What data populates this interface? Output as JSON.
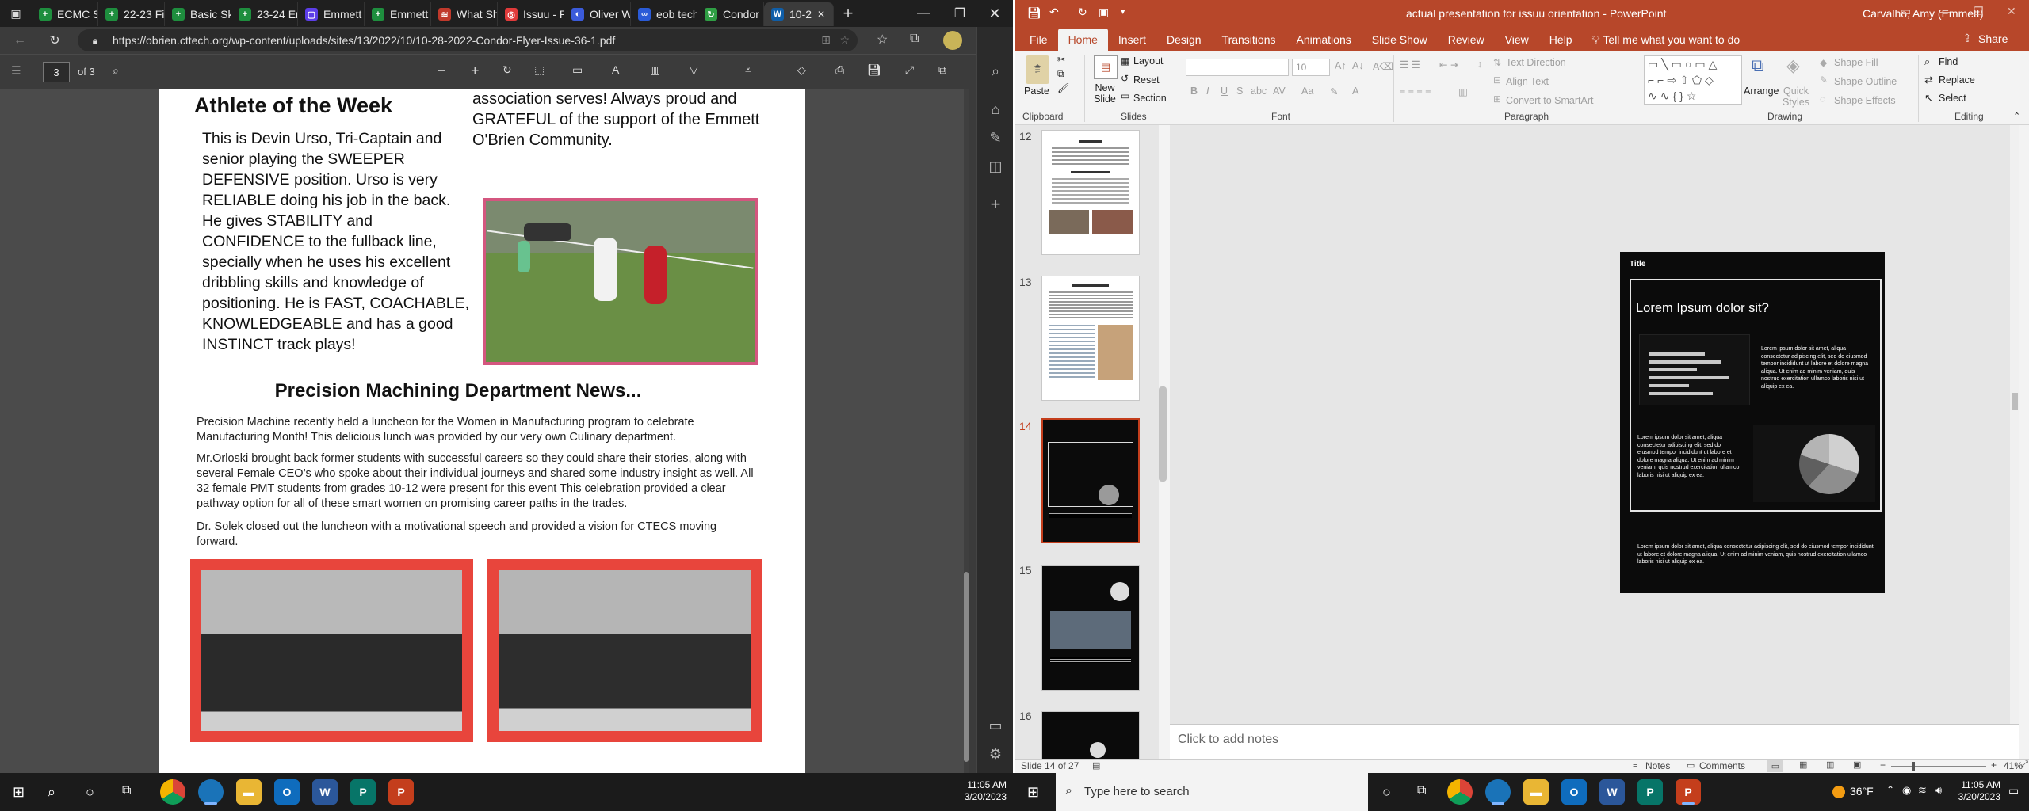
{
  "edge": {
    "tabs": [
      {
        "label": "ECMC St",
        "color": "#1e8e3e",
        "glyph": "+"
      },
      {
        "label": "22-23 Fi",
        "color": "#1e8e3e",
        "glyph": "+"
      },
      {
        "label": "Basic Ski",
        "color": "#1e8e3e",
        "glyph": "+"
      },
      {
        "label": "23-24 Er",
        "color": "#1e8e3e",
        "glyph": "+"
      },
      {
        "label": "Emmett",
        "color": "#5c3ee8",
        "glyph": "▢"
      },
      {
        "label": "Emmett",
        "color": "#1e8e3e",
        "glyph": "+"
      },
      {
        "label": "What Sh",
        "color": "#c0392b",
        "glyph": "≋"
      },
      {
        "label": "Issuu - P",
        "color": "#e03a3a",
        "glyph": "◎"
      },
      {
        "label": "Oliver W",
        "color": "#3b5bdb",
        "glyph": "◐"
      },
      {
        "label": "eob tech",
        "color": "#2a5bd7",
        "glyph": "∞"
      },
      {
        "label": "Condor I",
        "color": "#2f9e44",
        "glyph": "↻"
      },
      {
        "label": "10-2",
        "color": "#0f5ea8",
        "glyph": "W"
      }
    ],
    "url": "https://obrien.cttech.org/wp-content/uploads/sites/13/2022/10/10-28-2022-Condor-Flyer-Issue-36-1.pdf",
    "pdf": {
      "page": "3",
      "of": "of 3"
    },
    "doc": {
      "partial_top": "association serves! Always proud and GRATEFUL of the support of the Emmett O'Brien Community.",
      "athlete_title": "Athlete of the Week",
      "athlete_body": "This is Devin Urso, Tri-Captain and senior playing the SWEEPER DEFENSIVE position.  Urso is very RELIABLE doing his job in the back. He gives STABILITY and CONFIDENCE to the fullback line, specially when he uses his excellent dribbling skills and knowledge of positioning.  He is FAST, COACHABLE, KNOWLEDGEABLE and has a good INSTINCT track plays!",
      "pm_title": "Precision Machining Department News...",
      "pm_p1": "Precision Machine recently held a luncheon for the Women in Manufacturing program to celebrate Manufacturing Month! This  delicious lunch was provided by our very own Culinary department.",
      "pm_p2": "Mr.Orloski brought back former students with successful careers so they could share their stories, along with several Female CEO’s who spoke about their individual journeys and shared some industry insight as well. All 32 female PMT students from grades 10-12 were present for this event This celebration provided a clear pathway option for all of these smart women on promising career paths in the trades.",
      "pm_p3": "Dr. Solek closed out the luncheon with a motivational speech and provided a vision for CTECS moving forward.",
      "photo_border": "#e8453c"
    }
  },
  "ppt": {
    "title": "actual presentation for issuu orientation  -  PowerPoint",
    "user": "Carvalho, Amy (Emmett)",
    "tabs": [
      "File",
      "Home",
      "Insert",
      "Design",
      "Transitions",
      "Animations",
      "Slide Show",
      "Review",
      "View",
      "Help"
    ],
    "tell_me": "Tell me what you want to do",
    "share": "Share",
    "ribbon": {
      "paste": "Paste",
      "new_slide": "New Slide",
      "layout": "Layout",
      "reset": "Reset",
      "section": "Section",
      "font_size": "10",
      "text_direction": "Text Direction",
      "align_text": "Align Text",
      "convert_smartart": "Convert to SmartArt",
      "arrange": "Arrange",
      "quick_styles": "Quick Styles",
      "shape_fill": "Shape Fill",
      "shape_outline": "Shape Outline",
      "shape_effects": "Shape Effects",
      "find": "Find",
      "replace": "Replace",
      "select": "Select",
      "groups": [
        "Clipboard",
        "Slides",
        "Font",
        "Paragraph",
        "Drawing",
        "Editing"
      ]
    },
    "thumbs": [
      "12",
      "13",
      "14",
      "15",
      "16"
    ],
    "slide": {
      "title_placeholder": "Title",
      "heading": "Lorem Ipsum dolor sit?",
      "p_right": "Lorem ipsum dolor sit amet, aliqua consectetur adipiscing elit, sed do eiusmod tempor incididunt ut labore et dolore magna aliqua. Ut enim ad minim veniam, quis nostrud exercitation ullamco laboris nisi ut aliquip ex ea.",
      "p_left": "Lorem ipsum dolor sit amet, aliqua consectetur adipiscing elit, sed do eiusmod tempor incididunt ut labore et dolore magna aliqua. Ut enim ad minim veniam, quis nostrud exercitation ullamco laboris nisi ut aliquip ex ea.",
      "p_bottom": "Lorem ipsum dolor sit amet, aliqua consectetur adipiscing elit, sed do eiusmod tempor incididunt ut labore et dolore magna aliqua. Ut enim ad minim veniam, quis nostrud exercitation ullamco laboris nisi ut aliquip ex ea."
    },
    "notes_placeholder": "Click to add notes",
    "status": {
      "slide": "Slide 14 of 27",
      "notes": "Notes",
      "comments": "Comments",
      "zoom": "41%"
    }
  },
  "taskbar": {
    "search": "Type here to search",
    "weather": "36°F",
    "time": "11:05 AM",
    "date": "3/20/2023"
  }
}
